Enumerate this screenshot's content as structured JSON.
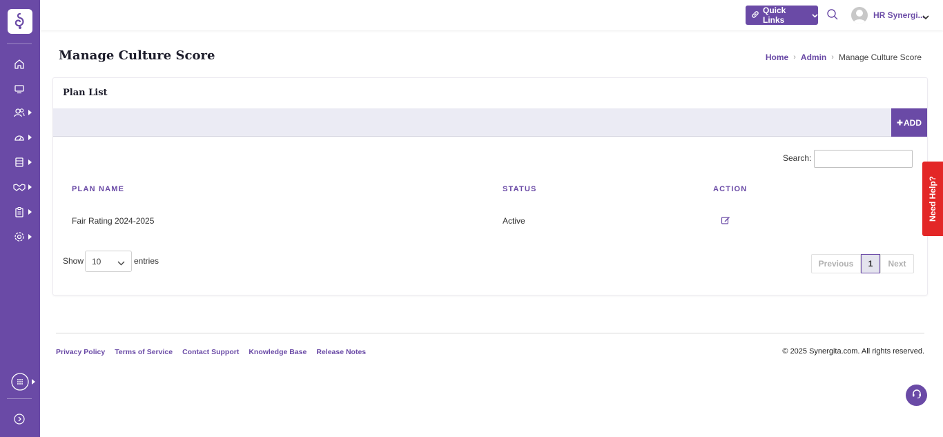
{
  "sidebar": {
    "items": [
      {
        "icon": "home-icon"
      },
      {
        "icon": "monitor-icon"
      },
      {
        "icon": "users-icon"
      },
      {
        "icon": "dashboard-gauge-icon"
      },
      {
        "icon": "database-icon"
      },
      {
        "icon": "handshake-icon"
      },
      {
        "icon": "clipboard-icon"
      },
      {
        "icon": "settings-icon"
      }
    ],
    "apps_icon": "grid-apps-icon",
    "expand_icon": "expand-arrow-icon"
  },
  "topbar": {
    "quick_links_label": "Quick Links",
    "user_name": "HR Synergi..."
  },
  "page": {
    "title": "Manage Culture Score",
    "breadcrumb": {
      "home": "Home",
      "admin": "Admin",
      "current": "Manage Culture Score"
    }
  },
  "card": {
    "title": "Plan List",
    "add_label": "ADD",
    "search_label": "Search:",
    "search_value": "",
    "columns": [
      "PLAN NAME",
      "STATUS",
      "ACTION"
    ],
    "rows": [
      {
        "plan_name": "Fair Rating 2024-2025",
        "status": "Active"
      }
    ],
    "show_label": "Show",
    "entries_value": "10",
    "entries_label": "entries",
    "pagination": {
      "previous": "Previous",
      "current_page": "1",
      "next": "Next"
    }
  },
  "footer": {
    "links": [
      "Privacy Policy",
      "Terms of Service",
      "Contact Support",
      "Knowledge Base",
      "Release Notes"
    ],
    "copyright": "© 2025 Synergita.com. All rights reserved."
  },
  "need_help_label": "Need Help?",
  "colors": {
    "brand_purple": "#6a4aa6",
    "help_red": "#e32727"
  }
}
